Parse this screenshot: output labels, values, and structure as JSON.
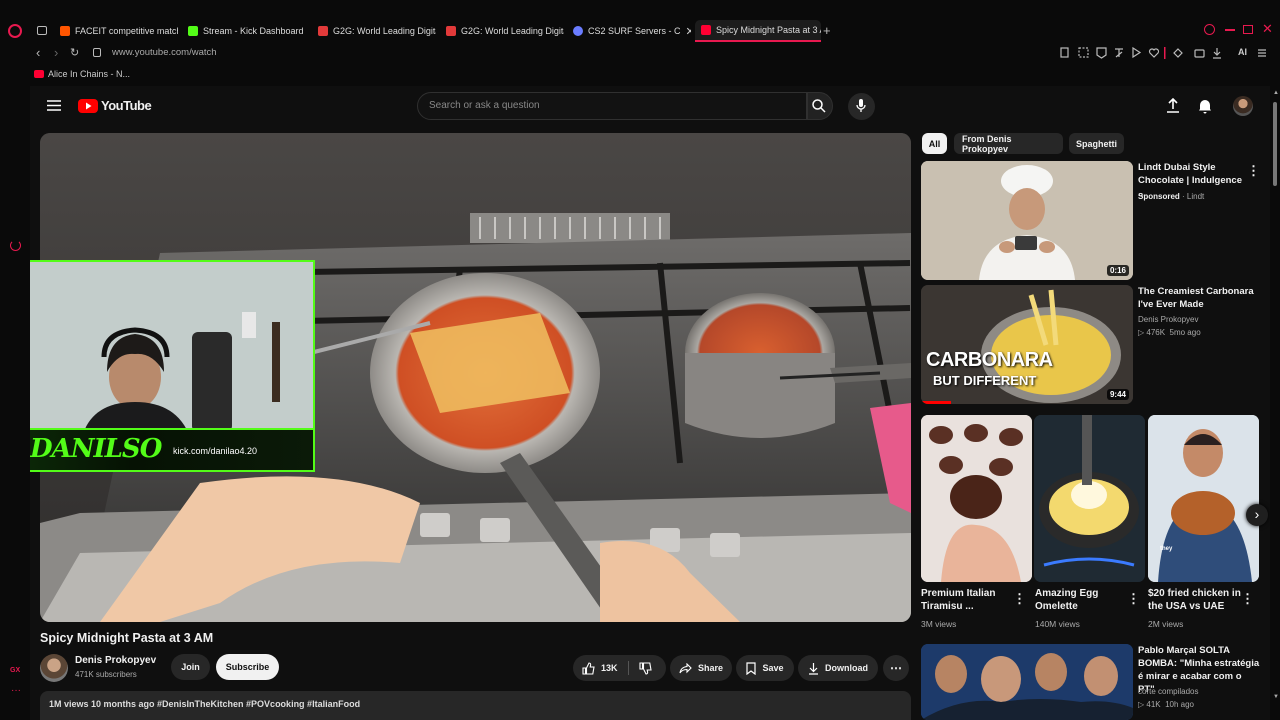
{
  "tabs": [
    {
      "label": "FACEIT competitive match",
      "color": "#ff5500"
    },
    {
      "label": "Stream - Kick Dashboard",
      "color": "#53fc18"
    },
    {
      "label": "G2G: World Leading Digita",
      "color": "#e23a3a"
    },
    {
      "label": "G2G: World Leading Digita",
      "color": "#e23a3a"
    },
    {
      "label": "CS2 SURF Servers - C",
      "color": "#6a7cff"
    },
    {
      "label": "Spicy Midnight Pasta at 3 A",
      "color": "#ff0033"
    }
  ],
  "address": {
    "url": "www.youtube.com/watch"
  },
  "bookmarks": {
    "item1": "Alice In Chains - N..."
  },
  "browser_tools": {
    "ai_label": "AI"
  },
  "sidebar": {
    "gx_label": "GX"
  },
  "header": {
    "logo_text": "YouTube",
    "search_placeholder": "Search or ask a question"
  },
  "overlay": {
    "streamer_name": "DANILSO",
    "kick_url": "kick.com/danilao4.20"
  },
  "video": {
    "title": "Spicy Midnight Pasta at 3 AM",
    "channel": "Denis Prokopyev",
    "subscribers": "471K subscribers",
    "join_label": "Join",
    "subscribe_label": "Subscribe",
    "likes": "13K",
    "share_label": "Share",
    "save_label": "Save",
    "download_label": "Download",
    "description_preview": "1M views  10 months ago  #DenisInTheKitchen #POVcooking #ItalianFood"
  },
  "chips": [
    "All",
    "From Denis Prokopyev",
    "Spaghetti"
  ],
  "recommendations": [
    {
      "title": "Lindt Dubai Style Chocolate | Indulgence ...",
      "sponsored": "Sponsored",
      "channel": "Lindt",
      "duration": "0:16"
    },
    {
      "title": "The Creamiest Carbonara I've Ever Made",
      "channel": "Denis Prokopyev",
      "views": "476K",
      "age": "5mo ago",
      "duration": "9:44",
      "thumb_text1": "CARBONARA",
      "thumb_text2": "BUT DIFFERENT"
    }
  ],
  "shorts": [
    {
      "title": "Premium Italian Tiramisu ...",
      "views": "3M views"
    },
    {
      "title": "Amazing Egg Omelette",
      "views": "140M views"
    },
    {
      "title": "$20 fried chicken in the USA vs UAE",
      "views": "2M views",
      "thumb_caption": "they"
    }
  ],
  "next_rec": {
    "title": "Pablo Marçal SOLTA BOMBA: \"Minha estratégia é mirar e acabar com o PT\"",
    "channel": "corte compilados",
    "views": "41K",
    "age": "10h ago"
  },
  "colors": {
    "yt_red": "#ff0000",
    "kick_green": "#53fc18",
    "opera_red": "#e8194f",
    "bg": "#0f0f0f"
  }
}
